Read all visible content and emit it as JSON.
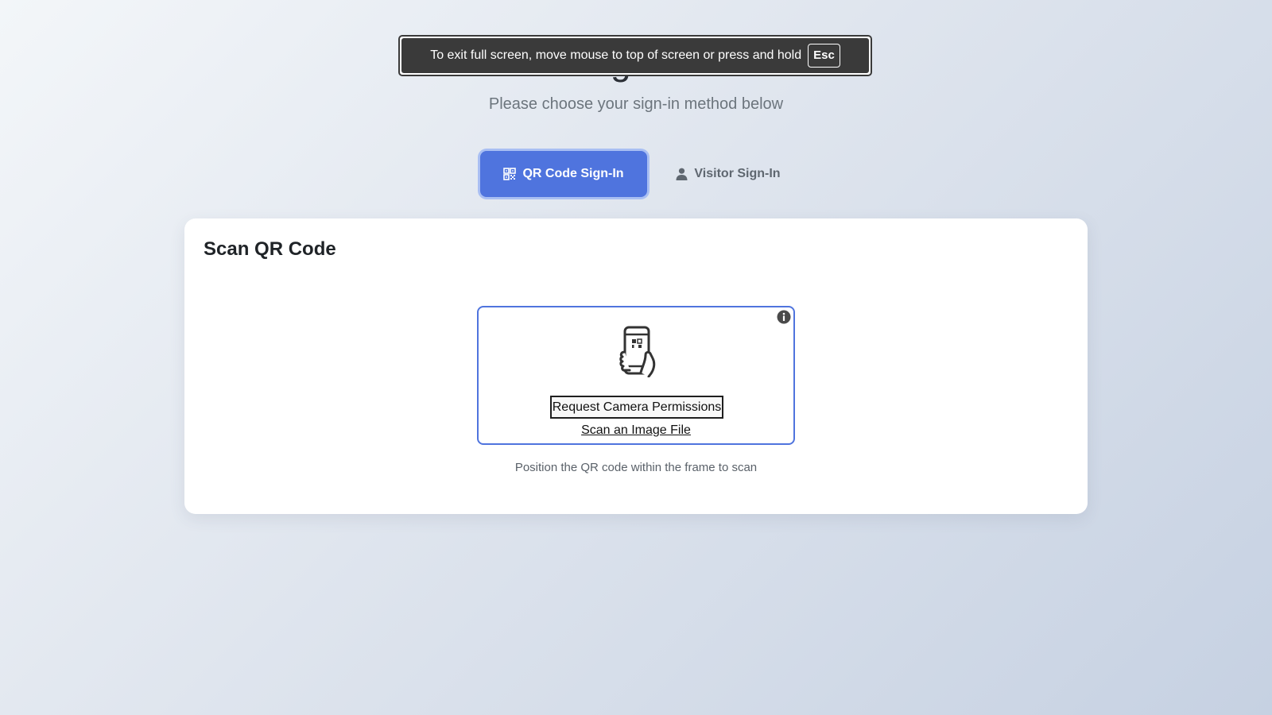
{
  "page": {
    "heading": "Sign-In",
    "subtitle": "Please choose your sign-in method below"
  },
  "fullscreen_notice": {
    "message": "To exit full screen, move mouse to top of screen or press and hold",
    "key": "Esc"
  },
  "tabs": [
    {
      "label": "QR Code Sign-In",
      "icon": "qr-code-icon",
      "active": true
    },
    {
      "label": "Visitor Sign-In",
      "icon": "person-icon",
      "active": false
    }
  ],
  "card": {
    "title": "Scan QR Code",
    "scanner": {
      "info_icon": "info-icon",
      "illustration_icon": "phone-qr-scan-icon",
      "camera_button_label": "Request Camera Permissions",
      "scan_file_label": "Scan an Image File"
    },
    "hint": "Position the QR code within the frame to scan"
  },
  "colors": {
    "accent": "#4f74de",
    "accent_ring": "#a9bff3",
    "notice_bg": "#3a3a3a"
  }
}
